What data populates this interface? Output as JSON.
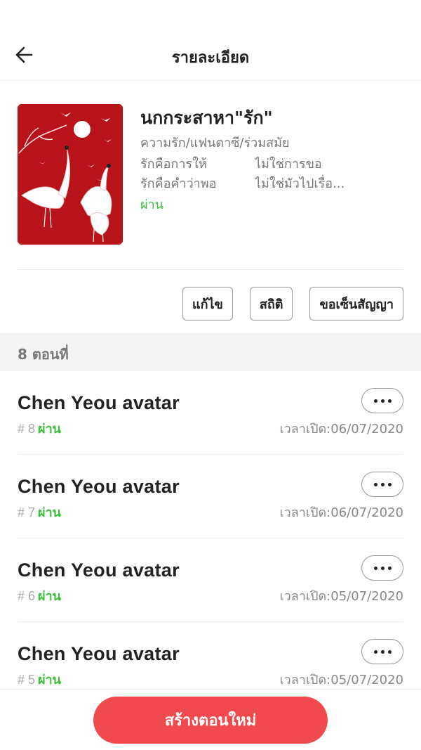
{
  "header": {
    "title": "รายละเอียด",
    "back_icon": "arrow-left-icon"
  },
  "book": {
    "title": "นกกระสาหา\"รัก\"",
    "genre": "ความรัก/แฟนตาซี/ร่วมสมัย",
    "tags": [
      "รักคือการให้",
      "ไม่ใช่การขอ",
      "รักคือคำว่าพอ",
      "ไม่ใช่มัวไปเรื่อ..."
    ],
    "status": "ผ่าน",
    "cover_color": "#c0161c"
  },
  "actions": {
    "edit": "แก้ไข",
    "stats": "สถิติ",
    "contract": "ขอเซ็นสัญญา"
  },
  "section": {
    "count_label": "8 ตอนที่"
  },
  "chapters": [
    {
      "title": "Chen Yeou avatar",
      "num": "# 8",
      "status": "ผ่าน",
      "date": "เวลาเปิด:06/07/2020"
    },
    {
      "title": "Chen Yeou avatar",
      "num": "# 7",
      "status": "ผ่าน",
      "date": "เวลาเปิด:06/07/2020"
    },
    {
      "title": "Chen Yeou avatar",
      "num": "# 6",
      "status": "ผ่าน",
      "date": "เวลาเปิด:05/07/2020"
    },
    {
      "title": "Chen Yeou avatar",
      "num": "# 5",
      "status": "ผ่าน",
      "date": "เวลาเปิด:05/07/2020"
    }
  ],
  "bottom": {
    "create_label": "สร้างตอนใหม่"
  },
  "colors": {
    "accent": "#f04a4f",
    "status_green": "#3cbf3c"
  }
}
